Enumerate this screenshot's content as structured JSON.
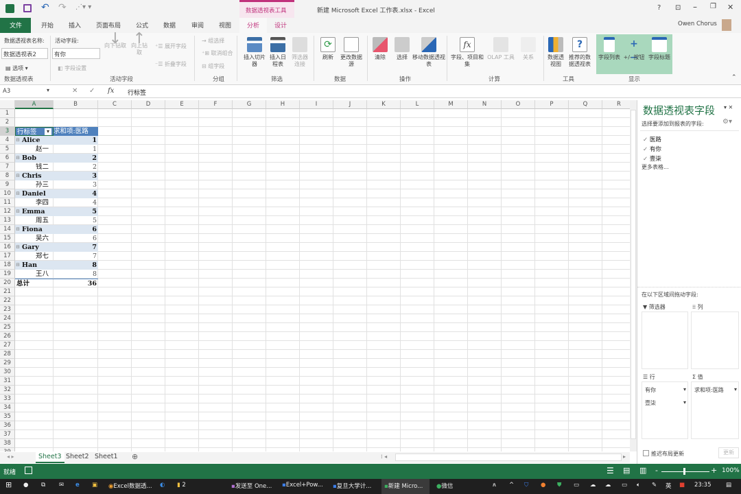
{
  "title": {
    "tool_context": "数据透视表工具",
    "doc": "新建 Microsoft Excel 工作表.xlsx - Excel",
    "user": "Owen Chorus",
    "help": "?"
  },
  "tabs": [
    "文件",
    "开始",
    "插入",
    "页面布局",
    "公式",
    "数据",
    "审阅",
    "视图",
    "分析",
    "设计"
  ],
  "active_tab": "分析",
  "ribbon": {
    "pt_name_label": "数据透视表名称:",
    "pt_name_value": "数据透视表2",
    "options": "选项",
    "group_pivot": "数据透视表",
    "active_field_label": "活动字段:",
    "active_field_value": "有你",
    "field_settings": "字段设置",
    "drill_down": "向下钻取",
    "drill_up": "向上钻取",
    "expand": "展开字段",
    "collapse": "折叠字段",
    "group_active": "活动字段",
    "group_selection": "组选择",
    "ungroup": "取消组合",
    "group_field": "组字段",
    "group_group": "分组",
    "insert_slicer": "插入切片器",
    "insert_timeline": "插入日程表",
    "filter_conn": "筛选器连接",
    "group_filter": "筛选",
    "refresh": "刷新",
    "change_source": "更改数据源",
    "group_data": "数据",
    "clear": "清除",
    "select": "选择",
    "move": "移动数据透视表",
    "group_actions": "操作",
    "fields_items": "字段、项目和集",
    "olap": "OLAP 工具",
    "relations": "关系",
    "group_calc": "计算",
    "pivotchart": "数据透视图",
    "recommended": "推荐的数据透视表",
    "group_tools": "工具",
    "field_list": "字段列表",
    "buttons": "+/- 按钮",
    "headers": "字段标题",
    "group_show": "显示"
  },
  "formula_bar": {
    "name_box": "A3",
    "fx": "fx",
    "value": "行标签"
  },
  "columns": [
    "A",
    "B",
    "C",
    "D",
    "E",
    "F",
    "G",
    "H",
    "I",
    "J",
    "K",
    "L",
    "M",
    "N",
    "O",
    "P",
    "Q",
    "R"
  ],
  "pivot": {
    "header_row": "行标签",
    "header_value": "求和项:医路",
    "rows": [
      {
        "label": "Alice",
        "value": "1",
        "type": "group"
      },
      {
        "label": "赵一",
        "value": "1",
        "type": "item"
      },
      {
        "label": "Bob",
        "value": "2",
        "type": "group"
      },
      {
        "label": "钱二",
        "value": "2",
        "type": "item"
      },
      {
        "label": "Chris",
        "value": "3",
        "type": "group"
      },
      {
        "label": "孙三",
        "value": "3",
        "type": "item"
      },
      {
        "label": "Daniel",
        "value": "4",
        "type": "group"
      },
      {
        "label": "李四",
        "value": "4",
        "type": "item"
      },
      {
        "label": "Emma",
        "value": "5",
        "type": "group"
      },
      {
        "label": "周五",
        "value": "5",
        "type": "item"
      },
      {
        "label": "Fiona",
        "value": "6",
        "type": "group"
      },
      {
        "label": "吴六",
        "value": "6",
        "type": "item"
      },
      {
        "label": "Gary",
        "value": "7",
        "type": "group"
      },
      {
        "label": "郑七",
        "value": "7",
        "type": "item"
      },
      {
        "label": "Han",
        "value": "8",
        "type": "group"
      },
      {
        "label": "王八",
        "value": "8",
        "type": "item"
      }
    ],
    "total_label": "总计",
    "total_value": "36"
  },
  "pane": {
    "title": "数据透视表字段",
    "subtitle": "选择要添加到报表的字段:",
    "fields": [
      {
        "name": "医路",
        "checked": true
      },
      {
        "name": "有你",
        "checked": true
      },
      {
        "name": "壹柒",
        "checked": true
      }
    ],
    "more": "更多表格...",
    "drag_label": "在以下区域间拖动字段:",
    "filters": "筛选器",
    "columns": "列",
    "rows": "行",
    "values": "值",
    "row_fields": [
      "有你",
      "壹柒"
    ],
    "value_fields": [
      "求和项:医路"
    ],
    "defer": "推迟布局更新",
    "update": "更新"
  },
  "sheets": [
    "Sheet3",
    "Sheet2",
    "Sheet1"
  ],
  "active_sheet": "Sheet3",
  "status": {
    "ready": "就绪",
    "zoom": "100%",
    "zoom_level": 100
  },
  "taskbar": {
    "items": [
      "Excel数据透...",
      "2",
      "发送至 One...",
      "Excel+Pow...",
      "复旦大学计...",
      "新建 Micro...",
      "微信"
    ],
    "ime": "英",
    "time": "23:35"
  },
  "colors": {
    "excel_green": "#217346",
    "pivot_header": "#4f81bd",
    "pivot_band": "#dce6f1",
    "context_tab": "#c0327c",
    "show_group_bg": "#a9d8bd"
  }
}
